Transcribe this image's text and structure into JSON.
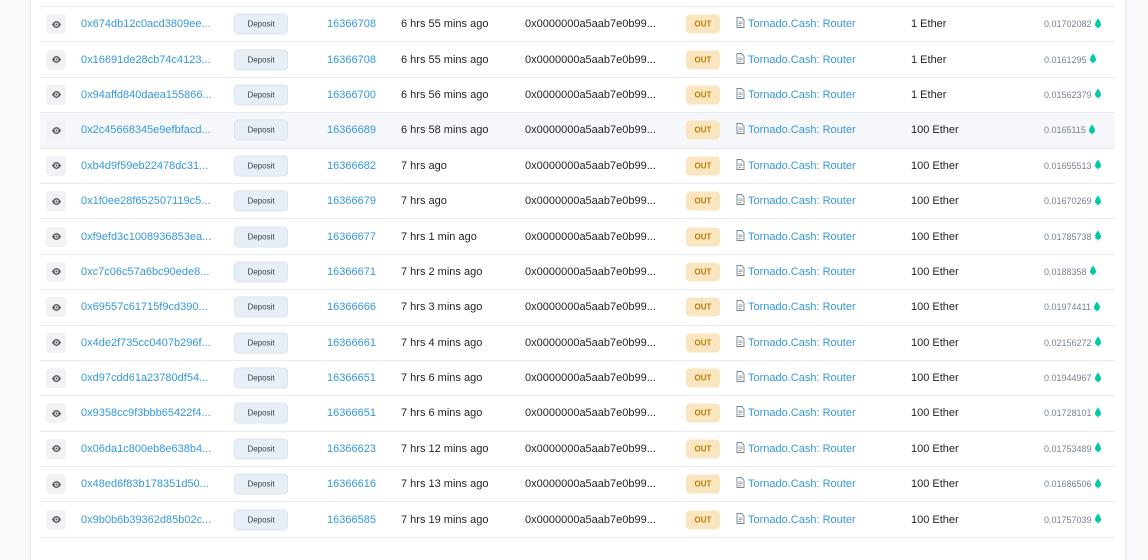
{
  "table": {
    "direction_label": "OUT",
    "method_label": "Deposit",
    "to_label": "Tornado.Cash: Router",
    "from_address": "0x0000000a5aab7e0b99...",
    "rows": [
      {
        "hash": "0x674db12c0acd3809ee...",
        "block": "16366708",
        "age": "6 hrs 55 mins ago",
        "value": "1 Ether",
        "fee": "0.01702082"
      },
      {
        "hash": "0x16691de28cb74c4123...",
        "block": "16366708",
        "age": "6 hrs 55 mins ago",
        "value": "1 Ether",
        "fee": "0.0161295"
      },
      {
        "hash": "0x94affd840daea155866...",
        "block": "16366700",
        "age": "6 hrs 56 mins ago",
        "value": "1 Ether",
        "fee": "0.01562379"
      },
      {
        "hash": "0x2c45668345e9efbfacd...",
        "block": "16366689",
        "age": "6 hrs 58 mins ago",
        "value": "100 Ether",
        "fee": "0.0165115"
      },
      {
        "hash": "0xb4d9f59eb22478dc31...",
        "block": "16366682",
        "age": "7 hrs ago",
        "value": "100 Ether",
        "fee": "0.01655513"
      },
      {
        "hash": "0x1f0ee28f652507119c5...",
        "block": "16366679",
        "age": "7 hrs ago",
        "value": "100 Ether",
        "fee": "0.01670269"
      },
      {
        "hash": "0xf9efd3c1008936853ea...",
        "block": "16366677",
        "age": "7 hrs 1 min ago",
        "value": "100 Ether",
        "fee": "0.01785738"
      },
      {
        "hash": "0xc7c06c57a6bc90ede8...",
        "block": "16366671",
        "age": "7 hrs 2 mins ago",
        "value": "100 Ether",
        "fee": "0.0188358"
      },
      {
        "hash": "0x69557c61715f9cd390...",
        "block": "16366666",
        "age": "7 hrs 3 mins ago",
        "value": "100 Ether",
        "fee": "0.01974411"
      },
      {
        "hash": "0x4de2f735cc0407b296f...",
        "block": "16366661",
        "age": "7 hrs 4 mins ago",
        "value": "100 Ether",
        "fee": "0.02156272"
      },
      {
        "hash": "0xd97cdd61a23780df54...",
        "block": "16366651",
        "age": "7 hrs 6 mins ago",
        "value": "100 Ether",
        "fee": "0.01944967"
      },
      {
        "hash": "0x9358cc9f3bbb65422f4...",
        "block": "16366651",
        "age": "7 hrs 6 mins ago",
        "value": "100 Ether",
        "fee": "0.01728101"
      },
      {
        "hash": "0x06da1c800eb8e638b4...",
        "block": "16366623",
        "age": "7 hrs 12 mins ago",
        "value": "100 Ether",
        "fee": "0.01753489"
      },
      {
        "hash": "0x48ed6f83b178351d50...",
        "block": "16366616",
        "age": "7 hrs 13 mins ago",
        "value": "100 Ether",
        "fee": "0.01686506"
      },
      {
        "hash": "0x9b0b6b39362d85b02c...",
        "block": "16366585",
        "age": "7 hrs 19 mins ago",
        "value": "100 Ether",
        "fee": "0.01757039"
      }
    ],
    "highlighted_row": 3
  },
  "icons": {
    "view": "eye-icon",
    "contract": "document-icon",
    "gas": "gas-drop-icon"
  },
  "colors": {
    "link": "#3498db",
    "out_badge_bg": "#f9e6c1",
    "out_badge_text": "#b47d00",
    "gas_icon": "#00c9a7"
  }
}
